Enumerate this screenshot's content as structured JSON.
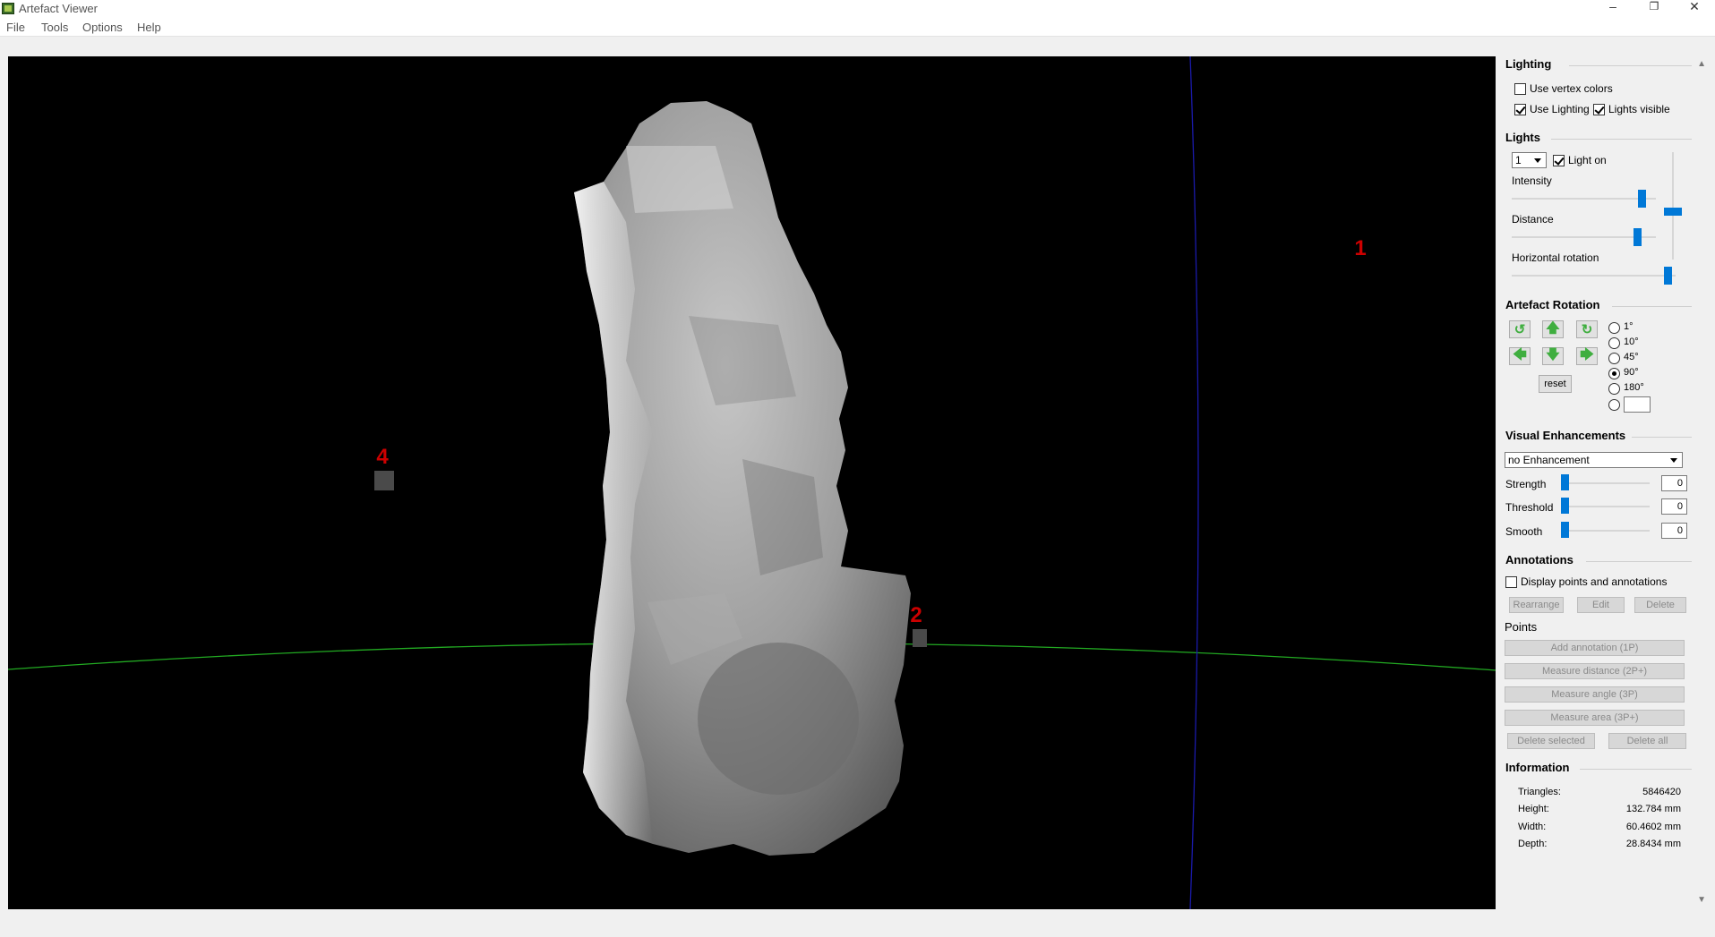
{
  "window": {
    "title": "Artefact Viewer",
    "minimize": "–",
    "restore": "❐",
    "close": "✕"
  },
  "menu": [
    "File",
    "Tools",
    "Options",
    "Help"
  ],
  "viewport": {
    "markers": [
      {
        "label": "1",
        "color": "#cc0000"
      },
      {
        "label": "2",
        "color": "#cc0000"
      },
      {
        "label": "4",
        "color": "#cc0000"
      }
    ],
    "axis_colors": {
      "horizontal": "#22aa22",
      "vertical": "#1a1aaa"
    },
    "background": "#000000"
  },
  "lighting": {
    "header": "Lighting",
    "use_vertex_colors": {
      "label": "Use vertex colors",
      "checked": false
    },
    "use_lighting": {
      "label": "Use Lighting",
      "checked": true
    },
    "lights_visible": {
      "label": "Lights visible",
      "checked": true
    }
  },
  "lights": {
    "header": "Lights",
    "selected_light": "1",
    "light_on": {
      "label": "Light on",
      "checked": true
    },
    "intensity_label": "Intensity",
    "distance_label": "Distance",
    "horizontal_rotation_label": "Horizontal rotation",
    "intensity_level": 0.9,
    "distance_level": 0.87,
    "horizontal_rotation_level": 0.95,
    "vertical_rotation_level": 0.55
  },
  "rotation": {
    "header": "Artefact Rotation",
    "reset_label": "reset",
    "steps": [
      "1°",
      "10°",
      "45°",
      "90°",
      "180°",
      ""
    ],
    "selected_step": "90°",
    "icons": [
      "rotate-ccw-icon",
      "arrow-up-icon",
      "rotate-cw-icon",
      "arrow-left-icon",
      "arrow-down-icon",
      "arrow-right-icon"
    ]
  },
  "visual": {
    "header": "Visual Enhancements",
    "mode": "no Enhancement",
    "strength_label": "Strength",
    "strength_value": "0",
    "threshold_label": "Threshold",
    "threshold_value": "0",
    "smooth_label": "Smooth",
    "smooth_value": "0"
  },
  "annotations": {
    "header": "Annotations",
    "display_label": "Display points and annotations",
    "display_checked": false,
    "rearrange": "Rearrange",
    "edit": "Edit",
    "delete": "Delete",
    "points_label": "Points",
    "add_annotation": "Add annotation (1P)",
    "measure_distance": "Measure distance (2P+)",
    "measure_angle": "Measure angle (3P)",
    "measure_area": "Measure area (3P+)",
    "delete_selected": "Delete selected",
    "delete_all": "Delete all"
  },
  "information": {
    "header": "Information",
    "triangles_label": "Triangles:",
    "triangles_value": "5846420",
    "height_label": "Height:",
    "height_value": "132.784 mm",
    "width_label": "Width:",
    "width_value": "60.4602 mm",
    "depth_label": "Depth:",
    "depth_value": "28.8434 mm"
  }
}
